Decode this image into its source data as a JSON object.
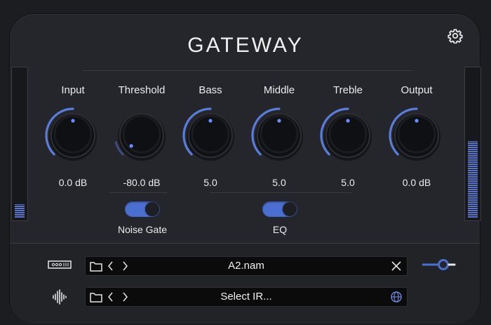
{
  "app": {
    "title": "GATEWAY"
  },
  "colors": {
    "accent": "#4a6fd1",
    "panel": "#25262b",
    "background": "#1c1d21"
  },
  "icons": {
    "settings": "gear-icon",
    "amp": "amp-model-icon",
    "ir": "waveform-icon",
    "folder": "folder-icon",
    "prev": "chevron-left-icon",
    "next": "chevron-right-icon",
    "clear": "close-icon",
    "web": "globe-icon",
    "slider": "slider-icon"
  },
  "meters": {
    "left_level": 0.09,
    "right_level": 0.52
  },
  "knobs": [
    {
      "label": "Input",
      "value": "0.0 dB",
      "fraction": 0.5
    },
    {
      "label": "Threshold",
      "value": "-80.0 dB",
      "fraction": 0.0
    },
    {
      "label": "Bass",
      "value": "5.0",
      "fraction": 0.5
    },
    {
      "label": "Middle",
      "value": "5.0",
      "fraction": 0.5
    },
    {
      "label": "Treble",
      "value": "5.0",
      "fraction": 0.5
    },
    {
      "label": "Output",
      "value": "0.0 dB",
      "fraction": 0.5
    }
  ],
  "toggles": {
    "noise_gate": {
      "label": "Noise Gate",
      "on": true
    },
    "eq": {
      "label": "EQ",
      "on": true
    }
  },
  "model_slot": {
    "value": "A2.nam"
  },
  "ir_slot": {
    "value": "Select IR..."
  }
}
